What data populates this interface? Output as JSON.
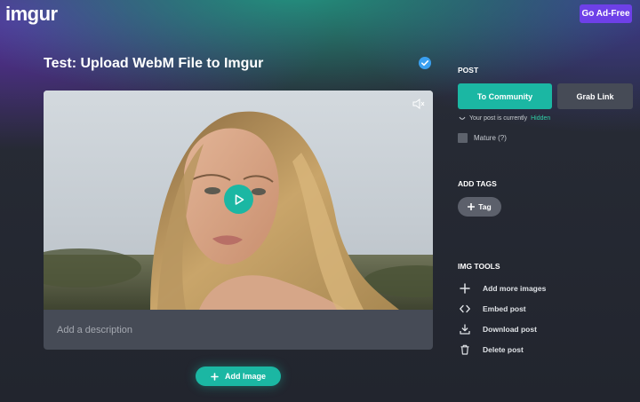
{
  "header": {
    "logo": "imgur",
    "go_adfree_label": "Go Ad-Free"
  },
  "post": {
    "title": "Test: Upload WebM File to Imgur",
    "description_placeholder": "Add a description",
    "add_image_label": "Add Image"
  },
  "sidebar": {
    "post_section": {
      "heading": "POST",
      "to_community_label": "To Community",
      "grab_link_label": "Grab Link",
      "visibility_prefix": "Your post is currently",
      "visibility_status": "Hidden",
      "mature_label": "Mature (?)"
    },
    "tags_section": {
      "heading": "ADD TAGS",
      "tag_label": "Tag"
    },
    "tools_section": {
      "heading": "IMG TOOLS",
      "items": [
        {
          "label": "Add more images",
          "icon": "plus-icon"
        },
        {
          "label": "Embed post",
          "icon": "code-icon"
        },
        {
          "label": "Download post",
          "icon": "download-icon"
        },
        {
          "label": "Delete post",
          "icon": "trash-icon"
        }
      ]
    }
  },
  "colors": {
    "accent_teal": "#1bb7a3",
    "adfree_purple": "#6e40e8",
    "hidden_green": "#2fd0a8",
    "panel_gray": "#464b56"
  }
}
